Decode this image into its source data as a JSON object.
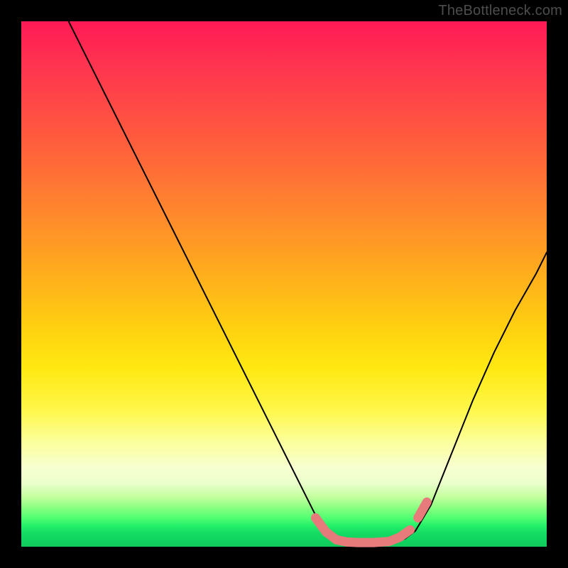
{
  "watermark": "TheBottleneck.com",
  "chart_data": {
    "type": "line",
    "title": "",
    "xlabel": "",
    "ylabel": "",
    "xlim": [
      0,
      100
    ],
    "ylim": [
      0,
      100
    ],
    "series": [
      {
        "name": "black-curve",
        "color": "#000000",
        "x": [
          9,
          15,
          22,
          30,
          38,
          45,
          52,
          56,
          58.5,
          60,
          62,
          65,
          68,
          71,
          73,
          75,
          78,
          82,
          86,
          90,
          94,
          98,
          100
        ],
        "y": [
          100,
          88,
          74,
          58,
          42,
          28,
          14,
          6,
          2.5,
          1.2,
          0.8,
          0.7,
          0.7,
          0.9,
          1.5,
          3,
          8,
          18,
          28,
          37,
          45,
          52,
          56
        ]
      },
      {
        "name": "pink-highlight",
        "color": "#e77a7a",
        "x": [
          56,
          58,
          60,
          62,
          64,
          67,
          70,
          72,
          74
        ],
        "y": [
          5.5,
          2.8,
          1.3,
          0.9,
          0.8,
          0.8,
          1.0,
          1.8,
          3.2
        ]
      },
      {
        "name": "pink-highlight-right",
        "color": "#e77a7a",
        "x": [
          75.5,
          77.2
        ],
        "y": [
          5.5,
          8.5
        ]
      }
    ]
  }
}
